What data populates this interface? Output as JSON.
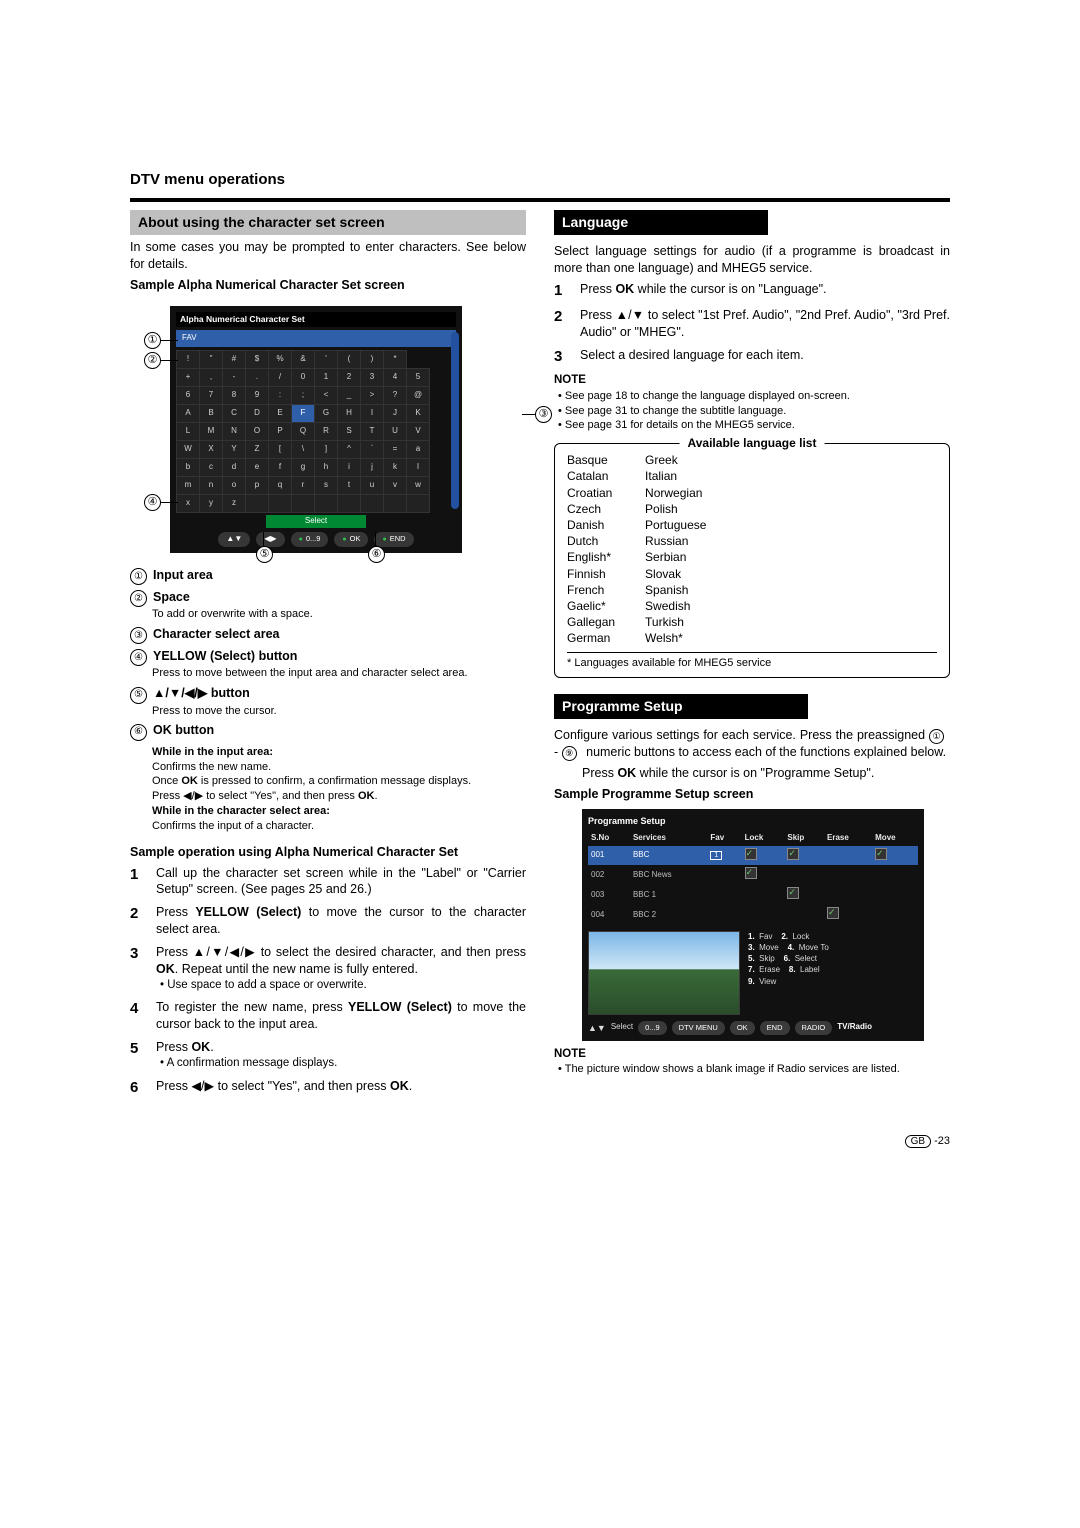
{
  "page_header": "DTV menu operations",
  "left": {
    "about_bar": "About using the character set screen",
    "intro": "In some cases you may be prompted to enter characters. See below for details.",
    "sample_header": "Sample Alpha Numerical Character Set screen",
    "charset_title": "Alpha Numerical Character Set",
    "fav": "FAV",
    "keyboard": [
      [
        "!",
        "\"",
        "#",
        "$",
        "%",
        "&",
        "'",
        "(",
        ")",
        "*"
      ],
      [
        "+",
        ",",
        "-",
        ".",
        "/",
        "0",
        "1",
        "2",
        "3",
        "4",
        "5"
      ],
      [
        "6",
        "7",
        "8",
        "9",
        ":",
        ";",
        "<",
        "_",
        ">",
        "?",
        "@"
      ],
      [
        "A",
        "B",
        "C",
        "D",
        "E",
        "F",
        "G",
        "H",
        "I",
        "J",
        "K"
      ],
      [
        "L",
        "M",
        "N",
        "O",
        "P",
        "Q",
        "R",
        "S",
        "T",
        "U",
        "V"
      ],
      [
        "W",
        "X",
        "Y",
        "Z",
        "[",
        "\\",
        "]",
        "^",
        "`",
        "=",
        "a"
      ],
      [
        "b",
        "c",
        "d",
        "e",
        "f",
        "g",
        "h",
        "i",
        "j",
        "k",
        "l"
      ],
      [
        "m",
        "n",
        "o",
        "p",
        "q",
        "r",
        "s",
        "t",
        "u",
        "v",
        "w"
      ],
      [
        "x",
        "y",
        "z",
        "",
        "",
        "",
        "",
        "",
        "",
        "",
        ""
      ]
    ],
    "highlight_cell": "F",
    "select_label": "Select",
    "bottom_pills": [
      "▲▼",
      "◀▶",
      "0...9",
      "OK",
      "END"
    ],
    "callouts": {
      "1": "①",
      "2": "②",
      "3": "③",
      "4": "④",
      "5": "⑤",
      "6": "⑥"
    },
    "legend": [
      {
        "n": "①",
        "title": "Input area",
        "body": ""
      },
      {
        "n": "②",
        "title": "Space",
        "body": "To add or overwrite with a space."
      },
      {
        "n": "③",
        "title": "Character select area",
        "body": ""
      },
      {
        "n": "④",
        "title": "YELLOW (Select) button",
        "body": "Press to move between the input area and character select area."
      },
      {
        "n": "⑤",
        "title": "▲/▼/◀/▶ button",
        "body": "Press to move the cursor."
      },
      {
        "n": "⑥",
        "title": "OK button",
        "body": ""
      }
    ],
    "ok_sub": {
      "h1": "While in the input area:",
      "l1": "Confirms the new name.",
      "l2_a": "Once ",
      "l2_b": "OK",
      "l2_c": " is pressed to confirm, a confirmation message displays.",
      "l3_a": "Press ◀/▶ to select \"Yes\", and then press ",
      "l3_b": "OK",
      "l3_c": ".",
      "h2": "While in the character select area:",
      "l4": "Confirms the input of a character."
    },
    "sample_op_header": "Sample operation using Alpha Numerical Character Set",
    "steps": [
      {
        "n": "1",
        "b": "Call up the character set screen while in the \"Label\" or \"Carrier Setup\" screen. (See pages 25 and 26.)"
      },
      {
        "n": "2",
        "b_pref": "Press ",
        "b_bold": "YELLOW (Select)",
        "b_suf": " to move the cursor to the character select area."
      },
      {
        "n": "3",
        "b_pref": "Press ▲/▼/◀/▶ to select the desired character, and then press ",
        "b_bold": "OK",
        "b_suf": ". Repeat until the new name is fully entered.",
        "bullet": "Use space to add a space or overwrite."
      },
      {
        "n": "4",
        "b_pref": "To register the new name, press ",
        "b_bold": "YELLOW (Select)",
        "b_suf": " to move the cursor back to the input area."
      },
      {
        "n": "5",
        "b_pref": "Press ",
        "b_bold": "OK",
        "b_suf": ".",
        "bullet": "A confirmation message displays."
      },
      {
        "n": "6",
        "b_pref": "Press ◀/▶ to select \"Yes\", and then press ",
        "b_bold": "OK",
        "b_suf": "."
      }
    ]
  },
  "right": {
    "language_bar": "Language",
    "language_intro": "Select language settings for audio (if a programme is broadcast in more than one language) and MHEG5 service.",
    "lang_steps": [
      {
        "n": "1",
        "pref": "Press ",
        "bold": "OK",
        "suf": " while the cursor is on \"Language\"."
      },
      {
        "n": "2",
        "pref": "Press ▲/▼ to select \"1st Pref. Audio\", \"2nd Pref. Audio\", \"3rd Pref. Audio\" or \"MHEG\".",
        "bold": "",
        "suf": ""
      },
      {
        "n": "3",
        "pref": "Select a desired language for each item.",
        "bold": "",
        "suf": ""
      }
    ],
    "note_label": "NOTE",
    "lang_notes": [
      "See page 18 to change the language displayed on-screen.",
      "See page 31 to change the subtitle language.",
      "See page 31 for details on the MHEG5 service."
    ],
    "lang_box_title": "Available language list",
    "lang_col1": [
      "Basque",
      "Catalan",
      "Croatian",
      "Czech",
      "Danish",
      "Dutch",
      "English*",
      "Finnish",
      "French",
      "Gaelic*",
      "Gallegan",
      "German"
    ],
    "lang_col2": [
      "Greek",
      "Italian",
      "Norwegian",
      "Polish",
      "Portuguese",
      "Russian",
      "Serbian",
      "Slovak",
      "Spanish",
      "Swedish",
      "Turkish",
      "Welsh*"
    ],
    "lang_footnote": "* Languages available for MHEG5 service",
    "prog_bar": "Programme Setup",
    "prog_intro_a": "Configure various settings for each service. Press the preassigned ",
    "prog_intro_b": " numeric buttons to access each of the functions explained below.",
    "prog_range_a": "①",
    "prog_range_b": "⑨",
    "prog_range_sep": " - ",
    "prog_step": "Press OK while the cursor is on \"Programme Setup\".",
    "prog_step_bold": "OK",
    "prog_sample_header": "Sample Programme Setup screen",
    "prog_title": "Programme Setup",
    "prog_cols": [
      "S.No",
      "Services",
      "Fav",
      "Lock",
      "Skip",
      "Erase",
      "Move"
    ],
    "prog_rows": [
      {
        "sno": "001",
        "svc": "BBC",
        "fav": "1",
        "lock": true,
        "skip": true,
        "erase": false,
        "move": true,
        "hl": true
      },
      {
        "sno": "002",
        "svc": "BBC News",
        "fav": "",
        "lock": true,
        "skip": false,
        "erase": false,
        "move": false
      },
      {
        "sno": "003",
        "svc": "BBC 1",
        "fav": "",
        "lock": false,
        "skip": true,
        "erase": false,
        "move": false
      },
      {
        "sno": "004",
        "svc": "BBC 2",
        "fav": "",
        "lock": false,
        "skip": false,
        "erase": true,
        "move": false
      }
    ],
    "prog_legend": [
      [
        "1.",
        "Fav",
        "2.",
        "Lock"
      ],
      [
        "3.",
        "Move",
        "4.",
        "Move To"
      ],
      [
        "5.",
        "Skip",
        "6.",
        "Select"
      ],
      [
        "7.",
        "Erase",
        "8.",
        "Label"
      ],
      [
        "9.",
        "View",
        "",
        ""
      ]
    ],
    "prog_bottom": [
      "▲▼",
      "Select",
      "0...9",
      "DTV MENU",
      "OK",
      "END",
      "RADIO",
      "TV/Radio"
    ],
    "prog_note_label": "NOTE",
    "prog_note": "The picture window shows a blank image if Radio services are listed."
  },
  "page_number": "-23",
  "page_region": "GB"
}
